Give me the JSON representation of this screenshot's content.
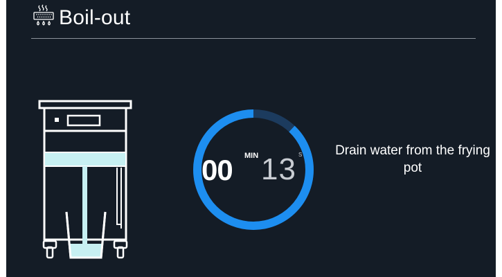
{
  "header": {
    "title": "Boil-out",
    "icon": "boil-out-icon"
  },
  "timer": {
    "minutes": "00",
    "minutes_label": "MIN",
    "seconds": "13",
    "seconds_label": "S",
    "progress_fraction": 0.88,
    "ring_color": "#1d8ef0",
    "track_color": "#1c3b5e"
  },
  "instruction": {
    "text": "Drain water from the frying pot"
  },
  "illustration": {
    "icon": "fryer-draining-icon",
    "water_color": "#c7f0f2"
  }
}
